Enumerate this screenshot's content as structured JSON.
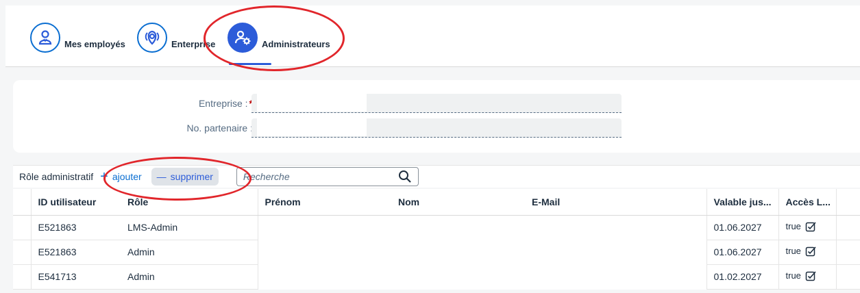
{
  "nav": {
    "items": [
      {
        "label": "Mes employés",
        "icon": "employee-icon",
        "active": false
      },
      {
        "label": "Enterprise",
        "icon": "location-icon",
        "active": false
      },
      {
        "label": "Administrateurs",
        "icon": "admin-settings-icon",
        "active": true
      }
    ]
  },
  "form": {
    "entreprise_label": "Entreprise :",
    "required_marker": "*",
    "partenaire_label": "No. partenaire :"
  },
  "toolbar": {
    "title": "Rôle administratif",
    "add_glyph": "+",
    "add_label": "ajouter",
    "remove_glyph": "—",
    "remove_label": "supprimer",
    "search_placeholder": "Recherche"
  },
  "table": {
    "columns": [
      "ID utilisateur",
      "Rôle",
      "Prénom",
      "Nom",
      "E-Mail",
      "Valable jus...",
      "Accès L..."
    ],
    "rows": [
      {
        "id": "E521863",
        "role": "LMS-Admin",
        "prenom": "",
        "nom": "",
        "email": "",
        "valid": "01.06.2027",
        "acces": "true"
      },
      {
        "id": "E521863",
        "role": "Admin",
        "prenom": "",
        "nom": "",
        "email": "",
        "valid": "01.06.2027",
        "acces": "true"
      },
      {
        "id": "E541713",
        "role": "Admin",
        "prenom": "",
        "nom": "",
        "email": "",
        "valid": "01.02.2027",
        "acces": "true"
      }
    ]
  },
  "colors": {
    "accent": "#2c5cd9",
    "link": "#0a6ed1",
    "annotation": "#e1262b",
    "required": "#bb0000"
  }
}
